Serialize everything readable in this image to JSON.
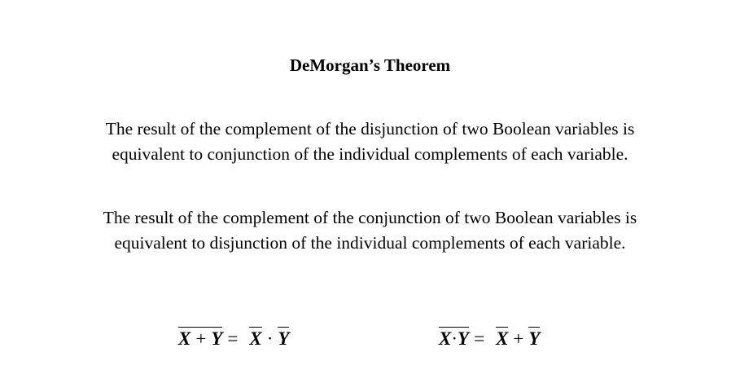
{
  "title": "DeMorgan’s Theorem",
  "paragraphs": [
    {
      "line1": "The result of the complement of the disjunction of two Boolean variables is",
      "line2": "equivalent to conjunction of the individual complements of each variable."
    },
    {
      "line1": "The result of the complement of the conjunction of two Boolean variables is",
      "line2": "equivalent to disjunction of the individual complements of each variable."
    }
  ],
  "formulas": {
    "first": {
      "lhs_var1": "X",
      "lhs_op": "+",
      "lhs_var2": "Y",
      "equals": "=",
      "rhs_var1": "X",
      "rhs_op": "·",
      "rhs_var2": "Y"
    },
    "second": {
      "lhs_var1": "X",
      "lhs_op": "·",
      "lhs_var2": "Y",
      "equals": "=",
      "rhs_var1": "X",
      "rhs_op": "+",
      "rhs_var2": "Y"
    }
  }
}
